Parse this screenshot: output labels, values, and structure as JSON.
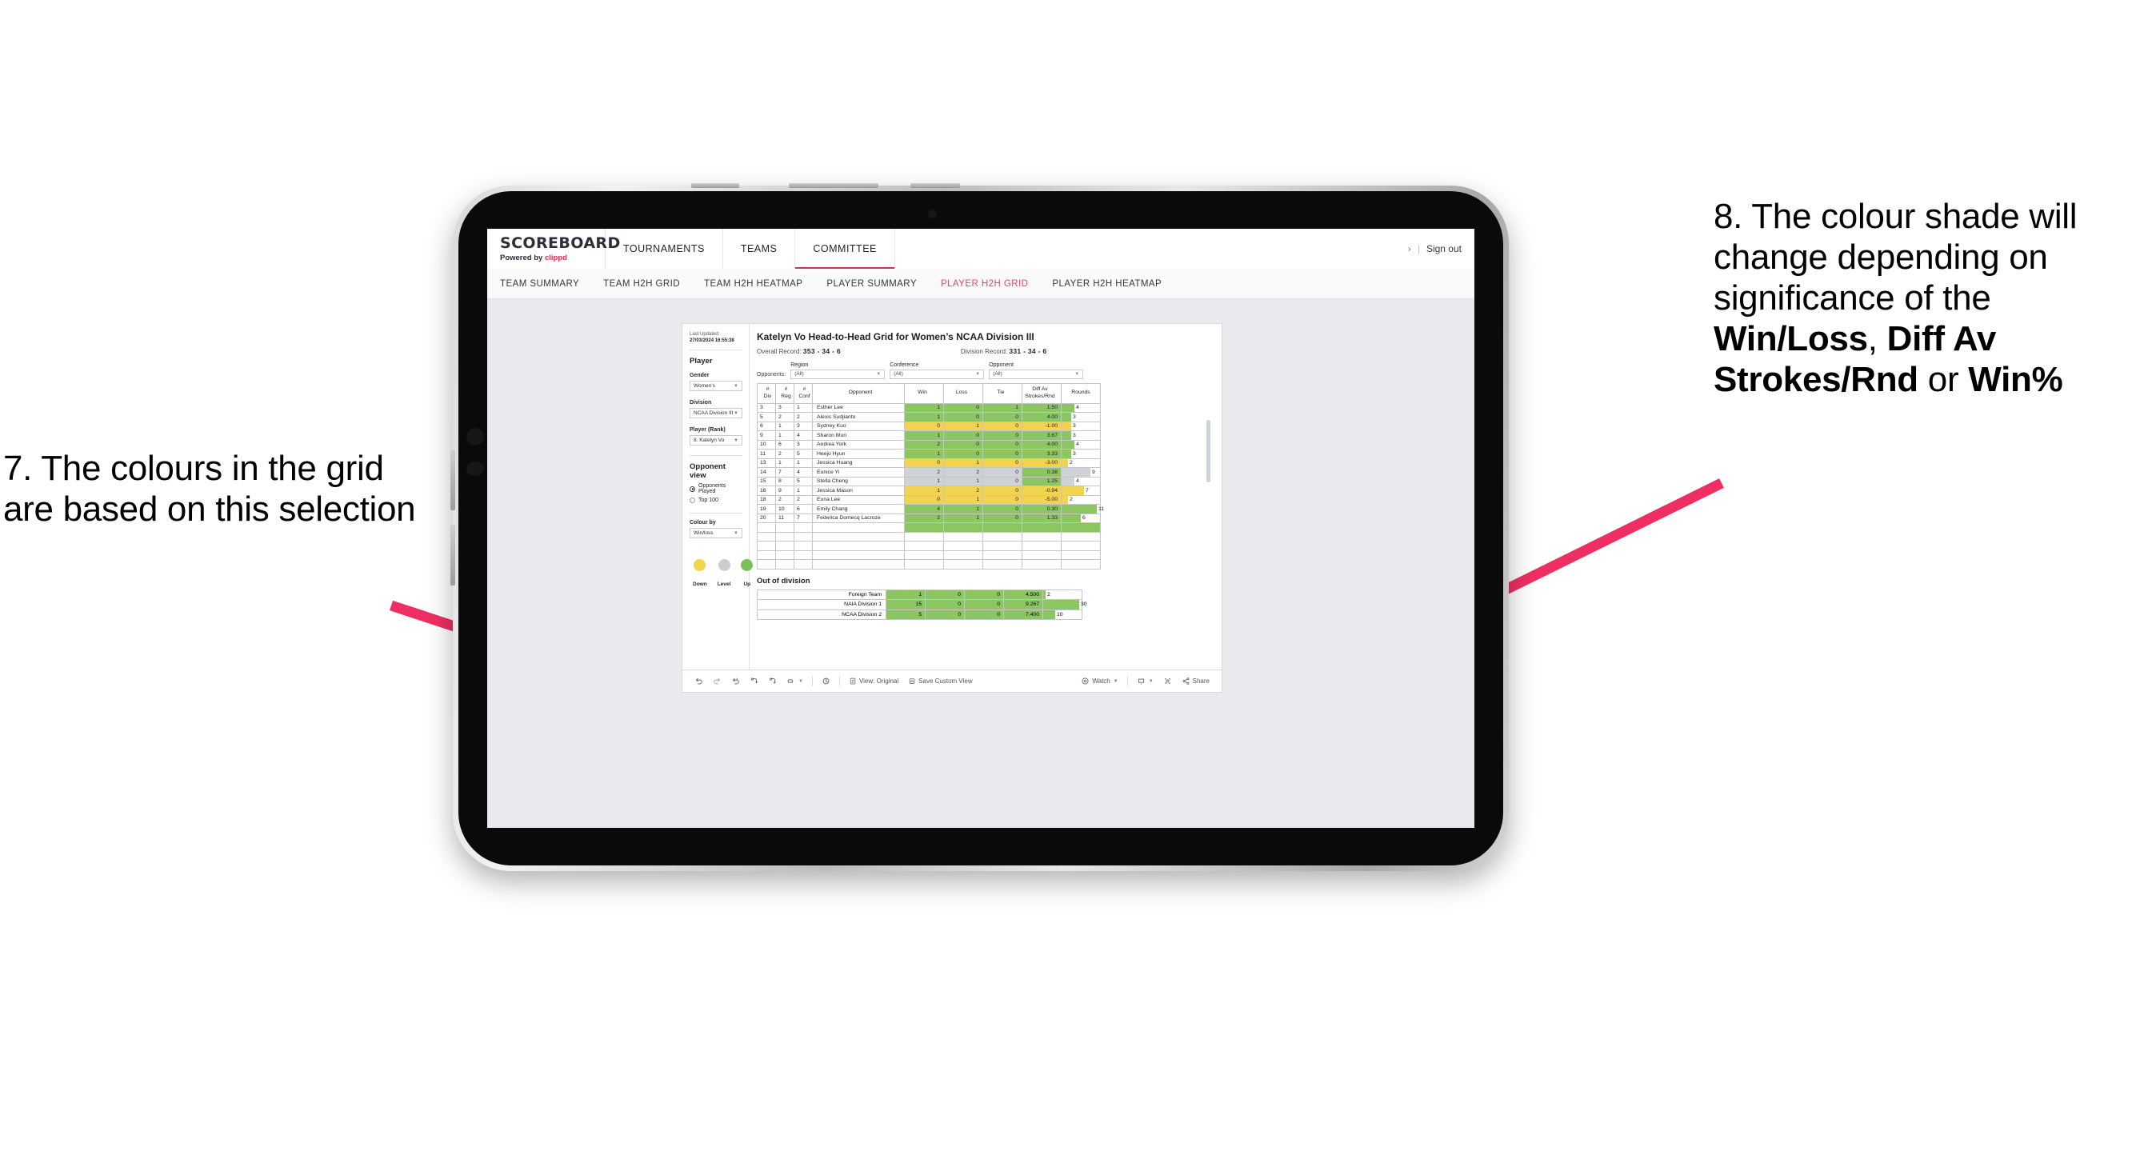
{
  "annotations": {
    "left": "7. The colours in the grid are based on this selection",
    "right_parts": [
      {
        "text": "8. The colour shade will change depending on significance of the ",
        "bold": false
      },
      {
        "text": "Win/Loss",
        "bold": true
      },
      {
        "text": ", ",
        "bold": false
      },
      {
        "text": "Diff Av Strokes/Rnd",
        "bold": true
      },
      {
        "text": " or ",
        "bold": false
      },
      {
        "text": "Win%",
        "bold": true
      }
    ],
    "arrow_color": "#ef2f62"
  },
  "header": {
    "brand_title": "SCOREBOARD",
    "brand_sub_prefix": "Powered by ",
    "brand_sub_accent": "clippd",
    "nav": [
      {
        "label": "TOURNAMENTS",
        "active": false
      },
      {
        "label": "TEAMS",
        "active": false
      },
      {
        "label": "COMMITTEE",
        "active": true
      }
    ],
    "chevron": "›",
    "separator": "|",
    "sign_out": "Sign out",
    "accent": "#c8355a"
  },
  "subnav": [
    {
      "label": "TEAM SUMMARY",
      "active": false
    },
    {
      "label": "TEAM H2H GRID",
      "active": false
    },
    {
      "label": "TEAM H2H HEATMAP",
      "active": false
    },
    {
      "label": "PLAYER SUMMARY",
      "active": false
    },
    {
      "label": "PLAYER H2H GRID",
      "active": true
    },
    {
      "label": "PLAYER H2H HEATMAP",
      "active": false
    }
  ],
  "panel": {
    "last_updated_label": "Last Updated: ",
    "last_updated_value": "27/03/2024 16:55:38",
    "heading": "Player",
    "filters": [
      {
        "label": "Gender",
        "value": "Women’s"
      },
      {
        "label": "Division",
        "value": "NCAA Division III"
      },
      {
        "label": "Player (Rank)",
        "value": "8. Katelyn Vo"
      }
    ],
    "opponent_view_heading": "Opponent view",
    "opponent_view_options": [
      {
        "label": "Opponents Played",
        "selected": true
      },
      {
        "label": "Top 100",
        "selected": false
      }
    ],
    "colour_by_label": "Colour by",
    "colour_by_value": "Win/loss",
    "legend": [
      {
        "label": "Down",
        "color": "#f2d449"
      },
      {
        "label": "Level",
        "color": "#c9cdd2"
      },
      {
        "label": "Up",
        "color": "#7cc05a"
      }
    ]
  },
  "viz": {
    "title": "Katelyn Vo Head-to-Head Grid for Women’s NCAA Division III",
    "overall_record_label": "Overall Record: ",
    "overall_record_value": "353 -  34 - 6",
    "division_record_label": "Division Record: ",
    "division_record_value": "331 -  34 - 6",
    "opponents_label": "Opponents:",
    "opponent_filters": [
      {
        "label": "Region",
        "value": "(All)"
      },
      {
        "label": "Conference",
        "value": "(All)"
      },
      {
        "label": "Opponent",
        "value": "(All)"
      }
    ],
    "ood_title": "Out of division"
  },
  "chart_data": {
    "type": "table",
    "title": "Katelyn Vo Head-to-Head Grid for Women’s NCAA Division III",
    "columns": [
      "# Div",
      "# Reg",
      "# Conf",
      "Opponent",
      "Win",
      "Loss",
      "Tie",
      "Diff Av Strokes/Rnd",
      "Rounds"
    ],
    "column_headers_multiline": [
      {
        "l1": "#",
        "l2": "Div"
      },
      {
        "l1": "#",
        "l2": "Reg"
      },
      {
        "l1": "#",
        "l2": "Conf"
      },
      {
        "l1": "Opponent",
        "l2": ""
      },
      {
        "l1": "Win",
        "l2": ""
      },
      {
        "l1": "Loss",
        "l2": ""
      },
      {
        "l1": "Tie",
        "l2": ""
      },
      {
        "l1": "Diff Av",
        "l2": "Strokes/Rnd"
      },
      {
        "l1": "Rounds",
        "l2": ""
      }
    ],
    "colour_by": "Win/loss",
    "colours": {
      "up": "#8cc663",
      "down": "#f2d34f",
      "level": "#cfd2d6",
      "white": "#ffffff"
    },
    "rounds_max": 12,
    "rows": [
      {
        "div": "3",
        "reg": "3",
        "conf": "1",
        "opponent": "Esther Lee",
        "win": "1",
        "loss": "0",
        "tie": "1",
        "diff": "1.50",
        "rounds": "4",
        "color": "up"
      },
      {
        "div": "5",
        "reg": "2",
        "conf": "2",
        "opponent": "Alexis Sudjianto",
        "win": "1",
        "loss": "0",
        "tie": "0",
        "diff": "4.00",
        "rounds": "3",
        "color": "up"
      },
      {
        "div": "6",
        "reg": "1",
        "conf": "3",
        "opponent": "Sydney Kuo",
        "win": "0",
        "loss": "1",
        "tie": "0",
        "diff": "-1.00",
        "rounds": "3",
        "color": "down"
      },
      {
        "div": "9",
        "reg": "1",
        "conf": "4",
        "opponent": "Sharon Mun",
        "win": "1",
        "loss": "0",
        "tie": "0",
        "diff": "3.67",
        "rounds": "3",
        "color": "up"
      },
      {
        "div": "10",
        "reg": "6",
        "conf": "3",
        "opponent": "Andrea York",
        "win": "2",
        "loss": "0",
        "tie": "0",
        "diff": "4.00",
        "rounds": "4",
        "color": "up"
      },
      {
        "div": "11",
        "reg": "2",
        "conf": "5",
        "opponent": "Heejo Hyun",
        "win": "1",
        "loss": "0",
        "tie": "0",
        "diff": "3.33",
        "rounds": "3",
        "color": "up"
      },
      {
        "div": "13",
        "reg": "1",
        "conf": "1",
        "opponent": "Jessica Huang",
        "win": "0",
        "loss": "1",
        "tie": "0",
        "diff": "-3.00",
        "rounds": "2",
        "color": "down"
      },
      {
        "div": "14",
        "reg": "7",
        "conf": "4",
        "opponent": "Eunice Yi",
        "win": "2",
        "loss": "2",
        "tie": "0",
        "diff": "0.38",
        "rounds": "9",
        "color": "level",
        "diff_color": "up"
      },
      {
        "div": "15",
        "reg": "8",
        "conf": "5",
        "opponent": "Stella Cheng",
        "win": "1",
        "loss": "1",
        "tie": "0",
        "diff": "1.25",
        "rounds": "4",
        "color": "level",
        "diff_color": "up"
      },
      {
        "div": "16",
        "reg": "9",
        "conf": "1",
        "opponent": "Jessica Mason",
        "win": "1",
        "loss": "2",
        "tie": "0",
        "diff": "-0.94",
        "rounds": "7",
        "color": "down"
      },
      {
        "div": "18",
        "reg": "2",
        "conf": "2",
        "opponent": "Euna Lee",
        "win": "0",
        "loss": "1",
        "tie": "0",
        "diff": "-5.00",
        "rounds": "2",
        "color": "down"
      },
      {
        "div": "19",
        "reg": "10",
        "conf": "6",
        "opponent": "Emily Chang",
        "win": "4",
        "loss": "1",
        "tie": "0",
        "diff": "0.30",
        "rounds": "11",
        "color": "up"
      },
      {
        "div": "20",
        "reg": "11",
        "conf": "7",
        "opponent": "Federica Domecq Lacroze",
        "win": "2",
        "loss": "1",
        "tie": "0",
        "diff": "1.33",
        "rounds": "6",
        "color": "up"
      }
    ],
    "out_of_division": {
      "title": "Out of division",
      "rounds_max": 32,
      "rows": [
        {
          "name": "Foreign Team",
          "win": "1",
          "loss": "0",
          "tie": "0",
          "diff": "4.500",
          "rounds": "2",
          "color": "up"
        },
        {
          "name": "NAIA Division 1",
          "win": "15",
          "loss": "0",
          "tie": "0",
          "diff": "9.267",
          "rounds": "30",
          "color": "up"
        },
        {
          "name": "NCAA Division 2",
          "win": "5",
          "loss": "0",
          "tie": "0",
          "diff": "7.400",
          "rounds": "10",
          "color": "up"
        }
      ]
    }
  },
  "toolbar": {
    "view_label": "View: Original",
    "save_label": "Save Custom View",
    "watch_label": "Watch",
    "share_label": "Share"
  }
}
